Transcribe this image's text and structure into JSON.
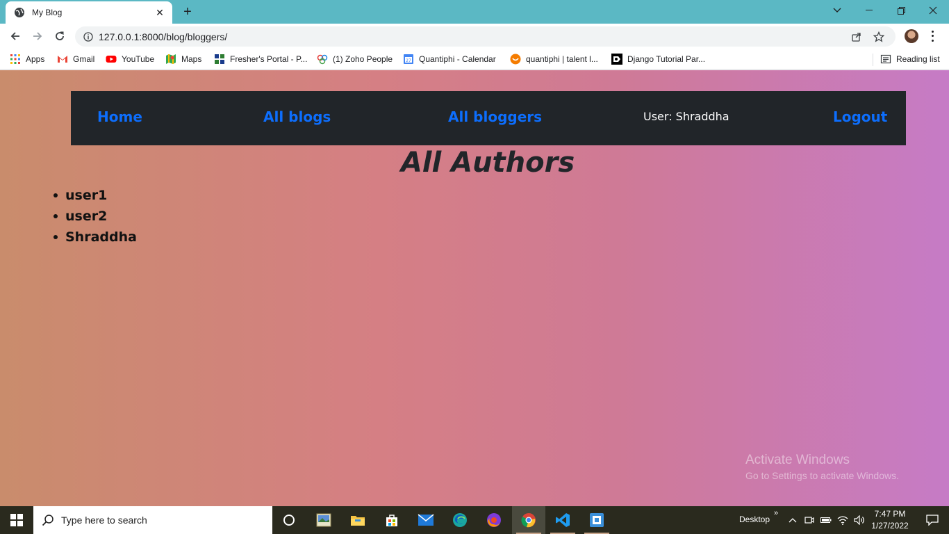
{
  "browser": {
    "tab_title": "My Blog",
    "url": "127.0.0.1:8000/blog/bloggers/",
    "bookmarks": [
      {
        "label": "Apps",
        "icon": "apps-grid-icon"
      },
      {
        "label": "Gmail",
        "icon": "gmail-icon"
      },
      {
        "label": "YouTube",
        "icon": "youtube-icon"
      },
      {
        "label": "Maps",
        "icon": "maps-icon"
      },
      {
        "label": "Fresher's Portal - P...",
        "icon": "fresher-portal-icon"
      },
      {
        "label": "(1) Zoho People",
        "icon": "zoho-people-icon"
      },
      {
        "label": "Quantiphi - Calendar",
        "icon": "calendar-icon"
      },
      {
        "label": "quantiphi | talent l...",
        "icon": "talent-icon"
      },
      {
        "label": "Django Tutorial Par...",
        "icon": "django-tutorial-icon"
      }
    ],
    "reading_list": "Reading list"
  },
  "page": {
    "nav": {
      "home": "Home",
      "all_blogs": "All blogs",
      "all_bloggers": "All bloggers",
      "user": "User: Shraddha",
      "logout": "Logout"
    },
    "heading": "All Authors",
    "authors": [
      "user1",
      "user2",
      "Shraddha"
    ],
    "colors": {
      "navbar_bg": "#212529",
      "link": "#0d6efd",
      "gradient_start": "#c98c6c",
      "gradient_end": "#c67bc6"
    }
  },
  "watermark": {
    "line1": "Activate Windows",
    "line2": "Go to Settings to activate Windows."
  },
  "taskbar": {
    "search_placeholder": "Type here to search",
    "desktop_label": "Desktop",
    "time": "7:47 PM",
    "date": "1/27/2022"
  }
}
